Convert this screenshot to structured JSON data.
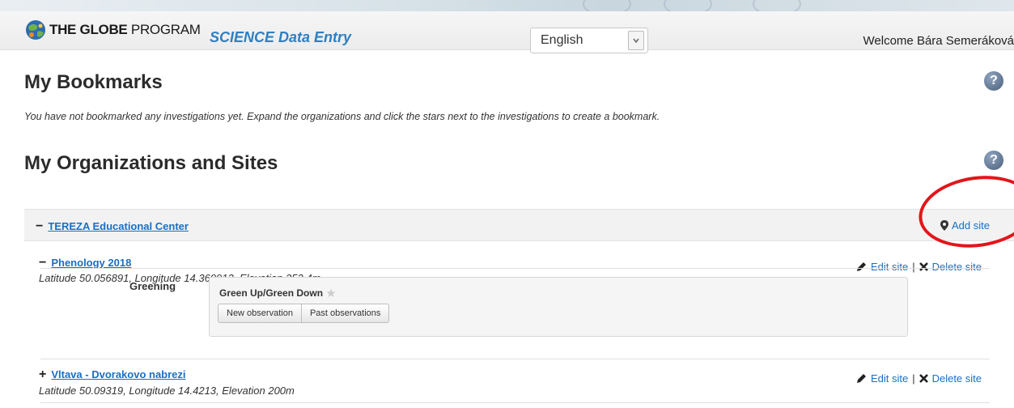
{
  "header": {
    "logo_text_bold": "THE GLOBE",
    "logo_text_rest": " PROGRAM",
    "app_title": "SCIENCE Data Entry",
    "language": {
      "selected": "English"
    },
    "welcome": "Welcome Bára Semeráková"
  },
  "bookmarks": {
    "title": "My Bookmarks",
    "note": "You have not bookmarked any investigations yet. Expand the organizations and click the stars next to the investigations to create a bookmark."
  },
  "organizations": {
    "title": "My Organizations and Sites",
    "org": {
      "toggle": "−",
      "name": "TEREZA Educational Center",
      "add_site": "Add site"
    },
    "sites": [
      {
        "toggle": "−",
        "name": "Phenology 2018",
        "coords": "Latitude 50.056891, Longitude 14.360912, Elevation 352.4m",
        "edit": "Edit site",
        "separator": "|",
        "delete": "Delete site",
        "protocol_group": "Greening",
        "protocol": {
          "title": "Green Up/Green Down",
          "new_btn": "New observation",
          "past_btn": "Past observations"
        }
      },
      {
        "toggle": "+",
        "name": "Vltava - Dvorakovo nabrezi",
        "coords": "Latitude 50.09319, Longitude 14.4213, Elevation 200m",
        "edit": "Edit site",
        "separator": "|",
        "delete": "Delete site"
      }
    ]
  },
  "help_icon_text": "?",
  "colors": {
    "link": "#1a6fc4",
    "title_accent": "#2f7fc1",
    "highlight_circle": "#e3151a"
  }
}
